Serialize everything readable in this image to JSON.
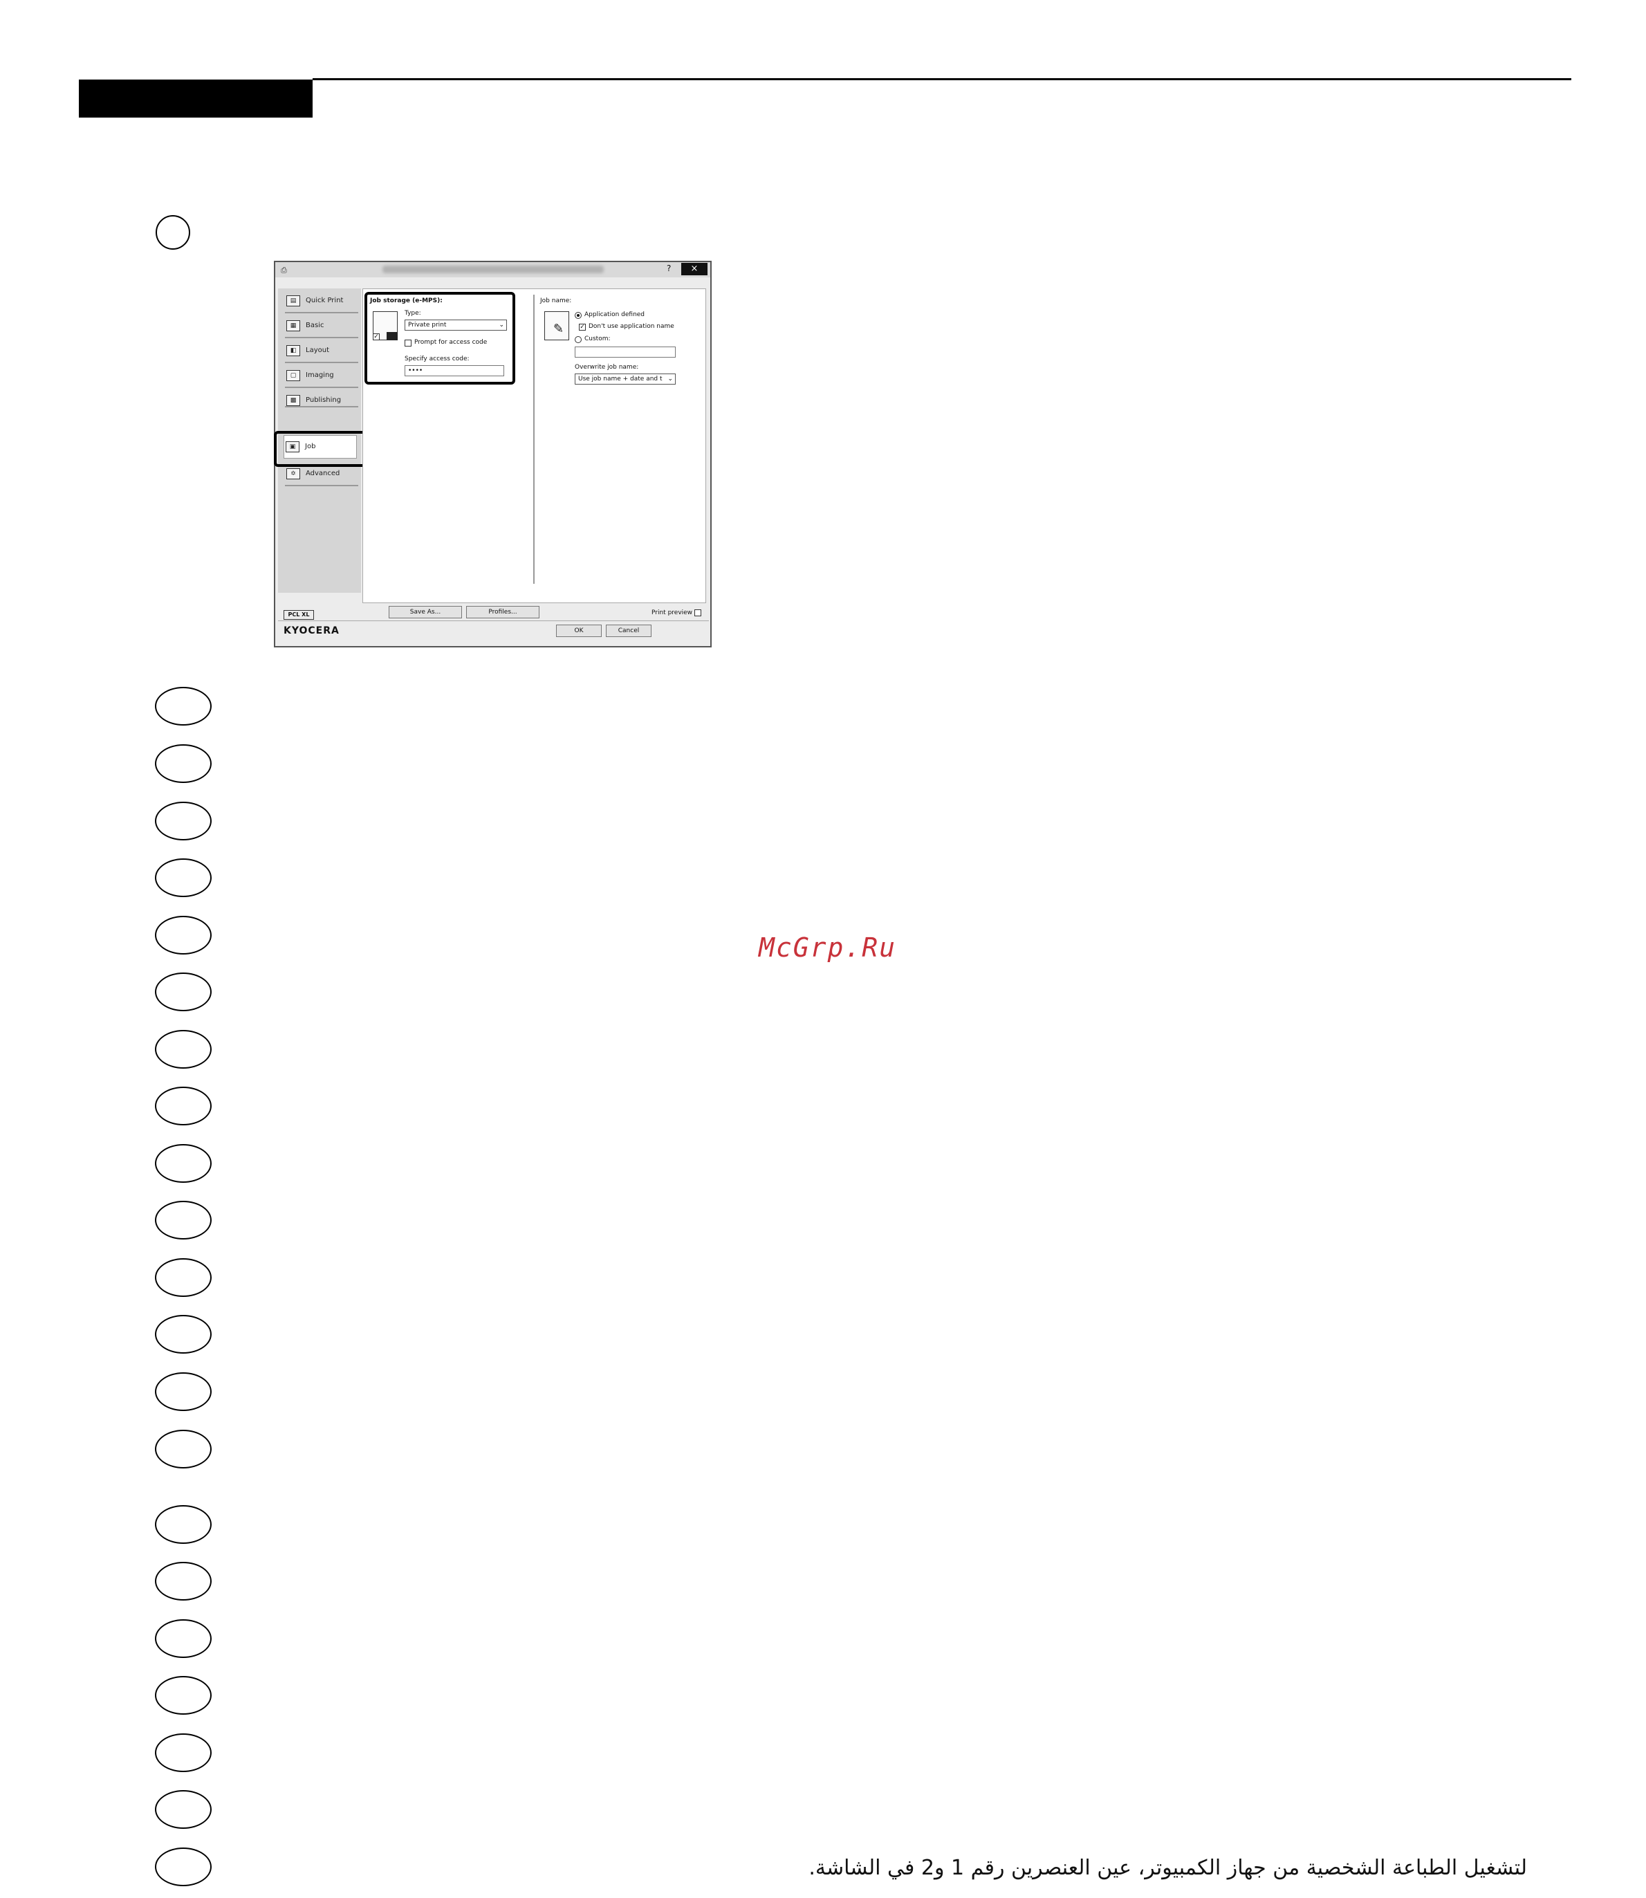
{
  "watermark": "McGrp.Ru",
  "instruction": "لتشغيل الطباعة الشخصية من جهاز الكمبيوتر، عين العنصرين رقم 1 و2 في الشاشة.",
  "dialog": {
    "help": "?",
    "close": "×",
    "sidebar": {
      "items": [
        {
          "label": "Quick Print",
          "icon": "quick-print-icon"
        },
        {
          "label": "Basic",
          "icon": "basic-icon"
        },
        {
          "label": "Layout",
          "icon": "layout-icon"
        },
        {
          "label": "Imaging",
          "icon": "imaging-icon"
        },
        {
          "label": "Publishing",
          "icon": "publishing-icon"
        },
        {
          "label": "Job",
          "icon": "job-icon"
        },
        {
          "label": "Advanced",
          "icon": "advanced-icon"
        }
      ]
    },
    "job_storage": {
      "heading": "Job storage (e-MPS):",
      "type_label": "Type:",
      "type_value": "Private print",
      "prompt_label": "Prompt for access code",
      "access_label": "Specify access code:",
      "access_value": "••••"
    },
    "job_name": {
      "heading": "Job name:",
      "app_defined": "Application defined",
      "dont_use": "Don't use application name",
      "custom": "Custom:",
      "overwrite_label": "Overwrite job name:",
      "overwrite_value": "Use job name + date and t"
    },
    "footer": {
      "pcl": "PCL XL",
      "save_as": "Save As...",
      "profiles": "Profiles...",
      "print_preview": "Print preview",
      "ok": "OK",
      "cancel": "Cancel",
      "logo": "KYOCERA"
    }
  }
}
